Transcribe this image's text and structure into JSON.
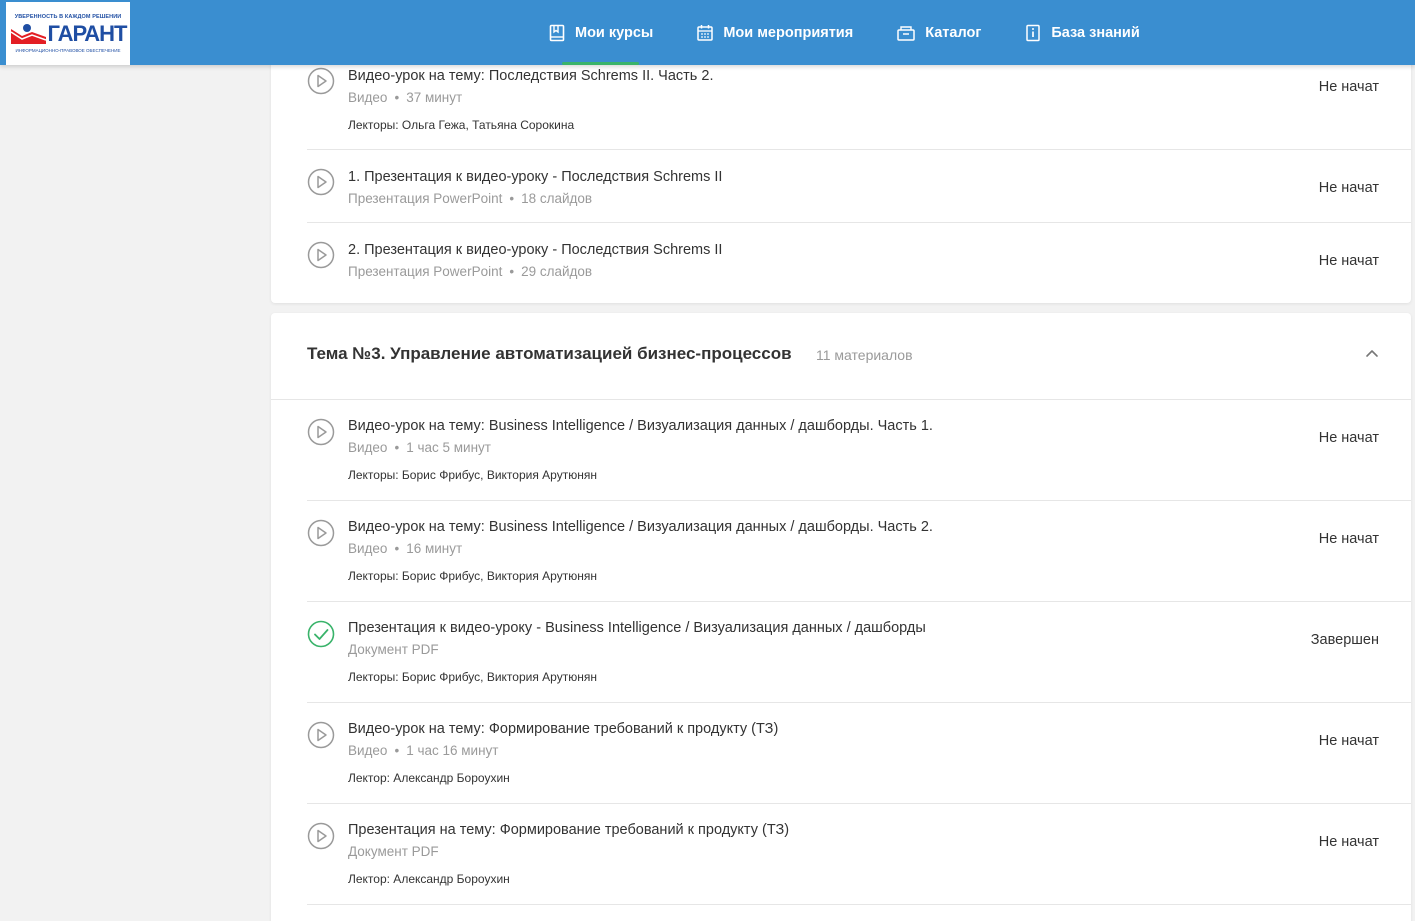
{
  "header": {
    "logo": {
      "tagline": "УВЕРЕННОСТЬ В КАЖДОМ РЕШЕНИИ",
      "name": "ГАРАНТ",
      "subtitle": "ИНФОРМАЦИОННО-ПРАВОВОЕ ОБЕСПЕЧЕНИЕ"
    },
    "nav": [
      {
        "label": "Мои курсы",
        "icon": "book-icon",
        "active": true
      },
      {
        "label": "Мои мероприятия",
        "icon": "calendar-icon"
      },
      {
        "label": "Каталог",
        "icon": "catalog-icon"
      },
      {
        "label": "База знаний",
        "icon": "knowledge-icon"
      }
    ]
  },
  "top_items": [
    {
      "title": "Видео-урок на тему:  Последствия Schrems II. Часть 2.",
      "type": "Видео",
      "detail": "37 минут",
      "lecturers": "Лекторы: Ольга Гежа, Татьяна Сорокина",
      "status": "Не начат",
      "icon": "play-icon"
    },
    {
      "title": "1. Презентация к видео-уроку  - Последствия Schrems II",
      "type": "Презентация PowerPoint",
      "detail": "18 слайдов",
      "status": "Не начат",
      "icon": "play-icon"
    },
    {
      "title": "2. Презентация к видео-уроку - Последствия Schrems II",
      "type": "Презентация PowerPoint",
      "detail": "29 слайдов",
      "status": "Не начат",
      "icon": "play-icon"
    }
  ],
  "section": {
    "title": "Тема №3. Управление автоматизацией бизнес-процессов",
    "count": "11 материалов",
    "items": [
      {
        "title": "Видео-урок на тему:  Business Intelligence / Визуализация данных / дашборды. Часть 1.",
        "type": "Видео",
        "detail": "1 час 5 минут",
        "lecturers": "Лекторы: Борис Фрибус, Виктория Арутюнян",
        "status": "Не начат",
        "icon": "play-icon"
      },
      {
        "title": "Видео-урок на тему: Business Intelligence / Визуализация данных / дашборды. Часть 2.",
        "type": "Видео",
        "detail": "16 минут",
        "lecturers": "Лекторы: Борис Фрибус, Виктория Арутюнян",
        "status": "Не начат",
        "icon": "play-icon"
      },
      {
        "title": "Презентация к видео-уроку - Business Intelligence / Визуализация данных / дашборды",
        "type": "Документ PDF",
        "lecturers": "Лекторы: Борис Фрибус, Виктория Арутюнян",
        "status": "Завершен",
        "icon": "check-circle-icon"
      },
      {
        "title": "Видео-урок на тему: Формирование требований к продукту (ТЗ)",
        "type": "Видео",
        "detail": "1 час 16 минут",
        "lecturers": "Лектор: Александр Бороухин",
        "status": "Не начат",
        "icon": "play-icon"
      },
      {
        "title": "Презентация на тему: Формирование требований к продукту (ТЗ)",
        "type": "Документ PDF",
        "lecturers": "Лектор: Александр Бороухин",
        "status": "Не начат",
        "icon": "play-icon"
      }
    ]
  },
  "colors": {
    "header_bg": "#3a8ed0",
    "active_underline": "#39b36a",
    "completed": "#39b36a",
    "icon_gray": "#9a9a9a"
  }
}
